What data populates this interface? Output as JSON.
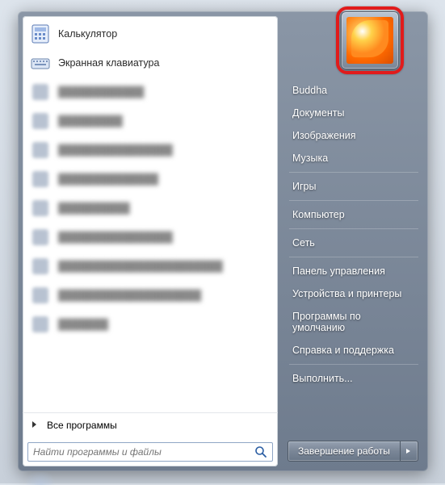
{
  "programs": [
    {
      "id": "calculator",
      "label": "Калькулятор",
      "icon": "calculator-icon",
      "blurred": false
    },
    {
      "id": "osk",
      "label": "Экранная клавиатура",
      "icon": "keyboard-icon",
      "blurred": false
    },
    {
      "id": "p3",
      "label": "████████████",
      "icon": "blur-icon",
      "blurred": true
    },
    {
      "id": "p4",
      "label": "█████████",
      "icon": "blur-icon",
      "blurred": true
    },
    {
      "id": "p5",
      "label": "████████████████",
      "icon": "blur-icon",
      "blurred": true
    },
    {
      "id": "p6",
      "label": "██████████████",
      "icon": "blur-icon",
      "blurred": true
    },
    {
      "id": "p7",
      "label": "██████████",
      "icon": "blur-icon",
      "blurred": true
    },
    {
      "id": "p8",
      "label": "████████████████",
      "icon": "blur-icon",
      "blurred": true
    },
    {
      "id": "p9",
      "label": "███████████████████████",
      "icon": "blur-icon",
      "blurred": true
    },
    {
      "id": "p10",
      "label": "████████████████████",
      "icon": "blur-icon",
      "blurred": true
    },
    {
      "id": "p11",
      "label": "███████",
      "icon": "blur-icon",
      "blurred": true
    }
  ],
  "all_programs_label": "Все программы",
  "search": {
    "placeholder": "Найти программы и файлы"
  },
  "user_name": "Buddha",
  "right_groups": [
    [
      "Buddha",
      "Документы",
      "Изображения",
      "Музыка"
    ],
    [
      "Игры"
    ],
    [
      "Компьютер"
    ],
    [
      "Сеть"
    ],
    [
      "Панель управления",
      "Устройства и принтеры",
      "Программы по умолчанию",
      "Справка и поддержка"
    ],
    [
      "Выполнить..."
    ]
  ],
  "shutdown_label": "Завершение работы"
}
